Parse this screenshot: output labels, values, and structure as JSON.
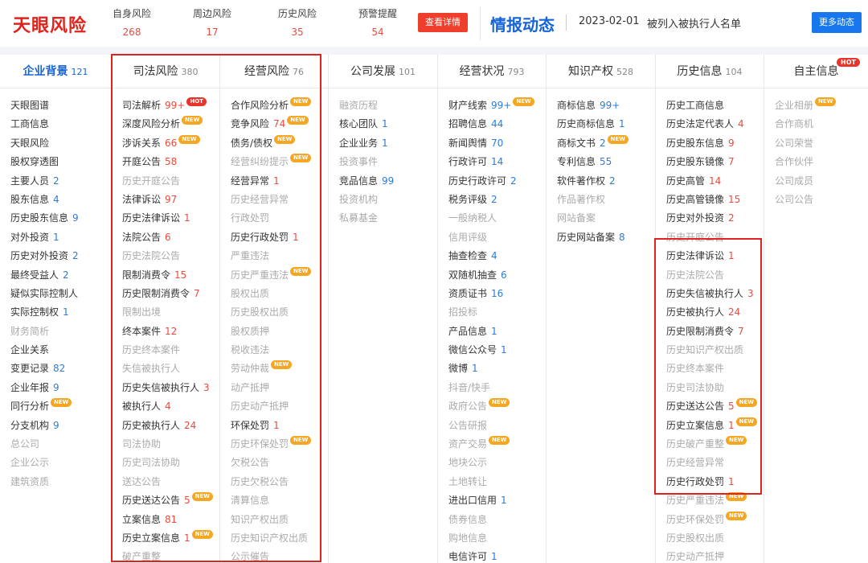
{
  "topbar": {
    "logo": "天眼风险",
    "risk_stats": [
      {
        "label": "自身风险",
        "count": "268"
      },
      {
        "label": "周边风险",
        "count": "17"
      },
      {
        "label": "历史风险",
        "count": "35"
      },
      {
        "label": "预警提醒",
        "count": "54"
      }
    ],
    "detail_button": "查看详情",
    "intel_title": "情报动态",
    "intel_date": "2023-02-01",
    "intel_text": "被列入被执行人名单",
    "more_button": "更多动态"
  },
  "colors": {
    "accent_blue": "#1565d8",
    "accent_red": "#e0241d",
    "count_red": "#e84c3d",
    "count_blue": "#2f7bd6",
    "badge_new": "#f5a623",
    "badge_hot": "#e8342b"
  },
  "columns": [
    {
      "title": "企业背景",
      "count": "121",
      "items": [
        {
          "label": "天眼图谱"
        },
        {
          "label": "工商信息"
        },
        {
          "label": "天眼风险"
        },
        {
          "label": "股权穿透图"
        },
        {
          "label": "主要人员",
          "count": "2"
        },
        {
          "label": "股东信息",
          "count": "4"
        },
        {
          "label": "历史股东信息",
          "count": "9"
        },
        {
          "label": "对外投资",
          "count": "1"
        },
        {
          "label": "历史对外投资",
          "count": "2"
        },
        {
          "label": "最终受益人",
          "count": "2"
        },
        {
          "label": "疑似实际控制人"
        },
        {
          "label": "实际控制权",
          "count": "1"
        },
        {
          "label": "财务简析",
          "muted": true
        },
        {
          "label": "企业关系"
        },
        {
          "label": "变更记录",
          "count": "82"
        },
        {
          "label": "企业年报",
          "count": "9"
        },
        {
          "label": "同行分析",
          "badge": "NEW"
        },
        {
          "label": "分支机构",
          "count": "9"
        },
        {
          "label": "总公司",
          "muted": true
        },
        {
          "label": "企业公示",
          "muted": true
        },
        {
          "label": "建筑资质",
          "muted": true
        }
      ]
    },
    {
      "title": "司法风险",
      "count": "380",
      "items": [
        {
          "label": "司法解析",
          "count": "99+",
          "badge": "HOT"
        },
        {
          "label": "深度风险分析",
          "badge": "NEW"
        },
        {
          "label": "涉诉关系",
          "count": "66",
          "badge": "NEW"
        },
        {
          "label": "开庭公告",
          "count": "58"
        },
        {
          "label": "历史开庭公告",
          "muted": true
        },
        {
          "label": "法律诉讼",
          "count": "97"
        },
        {
          "label": "历史法律诉讼",
          "count": "1"
        },
        {
          "label": "法院公告",
          "count": "6"
        },
        {
          "label": "历史法院公告",
          "muted": true
        },
        {
          "label": "限制消费令",
          "count": "15"
        },
        {
          "label": "历史限制消费令",
          "count": "7"
        },
        {
          "label": "限制出境",
          "muted": true
        },
        {
          "label": "终本案件",
          "count": "12"
        },
        {
          "label": "历史终本案件",
          "muted": true
        },
        {
          "label": "失信被执行人",
          "muted": true
        },
        {
          "label": "历史失信被执行人",
          "count": "3"
        },
        {
          "label": "被执行人",
          "count": "4"
        },
        {
          "label": "历史被执行人",
          "count": "24"
        },
        {
          "label": "司法协助",
          "muted": true
        },
        {
          "label": "历史司法协助",
          "muted": true
        },
        {
          "label": "送达公告",
          "muted": true
        },
        {
          "label": "历史送达公告",
          "count": "5",
          "badge": "NEW"
        },
        {
          "label": "立案信息",
          "count": "81"
        },
        {
          "label": "历史立案信息",
          "count": "1",
          "badge": "NEW"
        },
        {
          "label": "破产重整",
          "muted": true
        }
      ]
    },
    {
      "title": "经营风险",
      "count": "76",
      "items": [
        {
          "label": "合作风险分析",
          "badge": "NEW"
        },
        {
          "label": "竞争风险",
          "count": "74",
          "badge": "NEW"
        },
        {
          "label": "债务/债权",
          "badge": "NEW"
        },
        {
          "label": "经营纠纷提示",
          "muted": true,
          "badge": "NEW"
        },
        {
          "label": "经营异常",
          "count": "1"
        },
        {
          "label": "历史经营异常",
          "muted": true
        },
        {
          "label": "行政处罚",
          "muted": true
        },
        {
          "label": "历史行政处罚",
          "count": "1"
        },
        {
          "label": "严重违法",
          "muted": true
        },
        {
          "label": "历史严重违法",
          "muted": true,
          "badge": "NEW"
        },
        {
          "label": "股权出质",
          "muted": true
        },
        {
          "label": "历史股权出质",
          "muted": true
        },
        {
          "label": "股权质押",
          "muted": true
        },
        {
          "label": "税收违法",
          "muted": true
        },
        {
          "label": "劳动仲裁",
          "muted": true,
          "badge": "NEW"
        },
        {
          "label": "动产抵押",
          "muted": true
        },
        {
          "label": "历史动产抵押",
          "muted": true
        },
        {
          "label": "环保处罚",
          "count": "1"
        },
        {
          "label": "历史环保处罚",
          "muted": true,
          "badge": "NEW"
        },
        {
          "label": "欠税公告",
          "muted": true
        },
        {
          "label": "历史欠税公告",
          "muted": true
        },
        {
          "label": "清算信息",
          "muted": true
        },
        {
          "label": "知识产权出质",
          "muted": true
        },
        {
          "label": "历史知识产权出质",
          "muted": true
        },
        {
          "label": "公示催告",
          "muted": true
        }
      ]
    },
    {
      "title": "公司发展",
      "count": "101",
      "items": [
        {
          "label": "融资历程",
          "muted": true
        },
        {
          "label": "核心团队",
          "count": "1"
        },
        {
          "label": "企业业务",
          "count": "1"
        },
        {
          "label": "投资事件",
          "muted": true
        },
        {
          "label": "竞品信息",
          "count": "99"
        },
        {
          "label": "投资机构",
          "muted": true
        },
        {
          "label": "私募基金",
          "muted": true
        }
      ]
    },
    {
      "title": "经营状况",
      "count": "793",
      "items": [
        {
          "label": "财产线索",
          "count": "99+",
          "badge": "NEW"
        },
        {
          "label": "招聘信息",
          "count": "44"
        },
        {
          "label": "新闻舆情",
          "count": "70"
        },
        {
          "label": "行政许可",
          "count": "14"
        },
        {
          "label": "历史行政许可",
          "count": "2"
        },
        {
          "label": "税务评级",
          "count": "2"
        },
        {
          "label": "一般纳税人",
          "muted": true
        },
        {
          "label": "信用评级",
          "muted": true
        },
        {
          "label": "抽查检查",
          "count": "4"
        },
        {
          "label": "双随机抽查",
          "count": "6"
        },
        {
          "label": "资质证书",
          "count": "16"
        },
        {
          "label": "招投标",
          "muted": true
        },
        {
          "label": "产品信息",
          "count": "1"
        },
        {
          "label": "微信公众号",
          "count": "1"
        },
        {
          "label": "微博",
          "count": "1"
        },
        {
          "label": "抖音/快手",
          "muted": true
        },
        {
          "label": "政府公告",
          "muted": true,
          "badge": "NEW"
        },
        {
          "label": "公告研报",
          "muted": true
        },
        {
          "label": "资产交易",
          "muted": true,
          "badge": "NEW"
        },
        {
          "label": "地块公示",
          "muted": true
        },
        {
          "label": "土地转让",
          "muted": true
        },
        {
          "label": "进出口信用",
          "count": "1"
        },
        {
          "label": "债券信息",
          "muted": true
        },
        {
          "label": "购地信息",
          "muted": true
        },
        {
          "label": "电信许可",
          "count": "1"
        }
      ]
    },
    {
      "title": "知识产权",
      "count": "528",
      "items": [
        {
          "label": "商标信息",
          "count": "99+"
        },
        {
          "label": "历史商标信息",
          "count": "1"
        },
        {
          "label": "商标文书",
          "count": "2",
          "badge": "NEW"
        },
        {
          "label": "专利信息",
          "count": "55"
        },
        {
          "label": "软件著作权",
          "count": "2"
        },
        {
          "label": "作品著作权",
          "muted": true
        },
        {
          "label": "网站备案",
          "muted": true
        },
        {
          "label": "历史网站备案",
          "count": "8"
        }
      ]
    },
    {
      "title": "历史信息",
      "count": "104",
      "items": [
        {
          "label": "历史工商信息"
        },
        {
          "label": "历史法定代表人",
          "count": "4"
        },
        {
          "label": "历史股东信息",
          "count": "9"
        },
        {
          "label": "历史股东镜像",
          "count": "7"
        },
        {
          "label": "历史高管",
          "count": "14"
        },
        {
          "label": "历史高管镜像",
          "count": "15"
        },
        {
          "label": "历史对外投资",
          "count": "2"
        },
        {
          "label": "历史开庭公告",
          "muted": true
        },
        {
          "label": "历史法律诉讼",
          "count": "1"
        },
        {
          "label": "历史法院公告",
          "muted": true
        },
        {
          "label": "历史失信被执行人",
          "count": "3"
        },
        {
          "label": "历史被执行人",
          "count": "24"
        },
        {
          "label": "历史限制消费令",
          "count": "7"
        },
        {
          "label": "历史知识产权出质",
          "muted": true
        },
        {
          "label": "历史终本案件",
          "muted": true
        },
        {
          "label": "历史司法协助",
          "muted": true
        },
        {
          "label": "历史送达公告",
          "count": "5",
          "badge": "NEW"
        },
        {
          "label": "历史立案信息",
          "count": "1",
          "badge": "NEW"
        },
        {
          "label": "历史破产重整",
          "muted": true,
          "badge": "NEW"
        },
        {
          "label": "历史经营异常",
          "muted": true
        },
        {
          "label": "历史行政处罚",
          "count": "1"
        },
        {
          "label": "历史严重违法",
          "muted": true,
          "badge": "NEW"
        },
        {
          "label": "历史环保处罚",
          "muted": true,
          "badge": "NEW"
        },
        {
          "label": "历史股权出质",
          "muted": true
        },
        {
          "label": "历史动产抵押",
          "muted": true
        }
      ]
    },
    {
      "title": "自主信息",
      "badge": "HOT",
      "items": [
        {
          "label": "企业相册",
          "muted": true,
          "badge": "NEW"
        },
        {
          "label": "合作商机",
          "muted": true
        },
        {
          "label": "公司荣誉",
          "muted": true
        },
        {
          "label": "合作伙伴",
          "muted": true
        },
        {
          "label": "公司成员",
          "muted": true
        },
        {
          "label": "公司公告",
          "muted": true
        }
      ]
    }
  ]
}
